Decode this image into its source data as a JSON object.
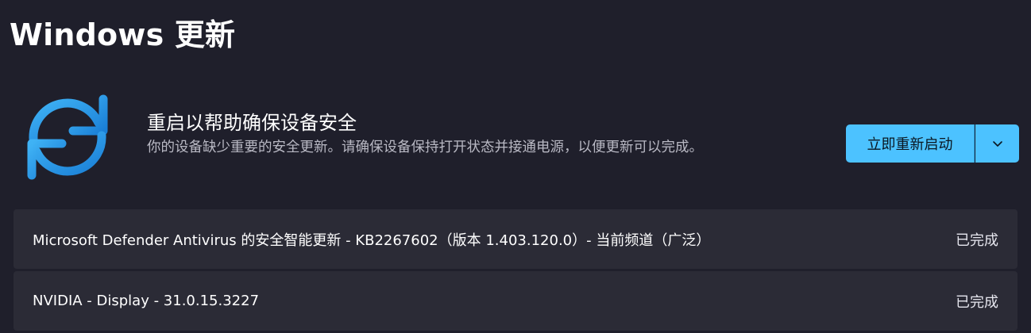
{
  "page": {
    "title": "Windows 更新"
  },
  "banner": {
    "icon": "sync-icon",
    "title": "重启以帮助确保设备安全",
    "description": "你的设备缺少重要的安全更新。请确保设备保持打开状态并接通电源，以便更新可以完成。",
    "restart_button_label": "立即重新启动",
    "dropdown_icon": "chevron-down-icon",
    "accent_color": "#4cc2ff"
  },
  "updates": [
    {
      "name": "Microsoft Defender Antivirus 的安全智能更新 - KB2267602（版本 1.403.120.0）- 当前频道（广泛）",
      "status": "已完成"
    },
    {
      "name": "NVIDIA - Display - 31.0.15.3227",
      "status": "已完成"
    }
  ]
}
